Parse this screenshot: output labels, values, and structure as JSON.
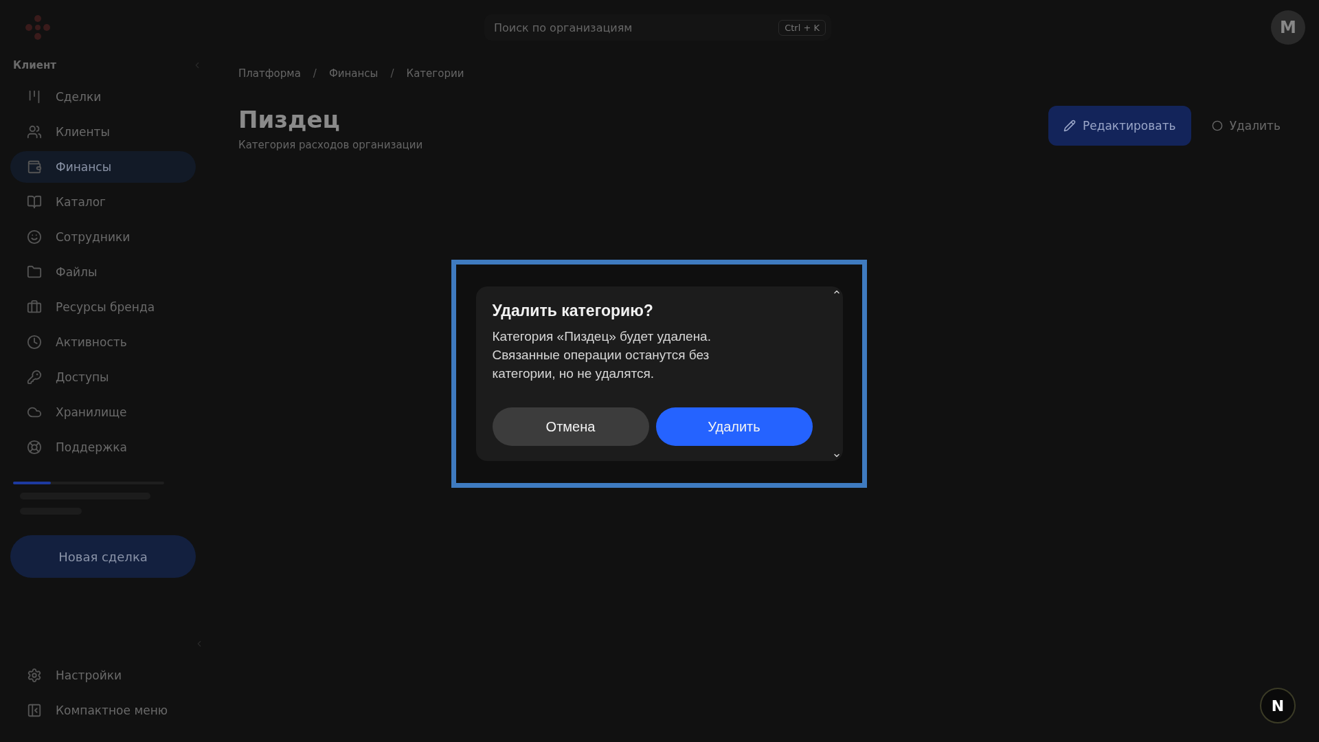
{
  "sidebar": {
    "section_label": "Клиент",
    "items": [
      {
        "label": "Сделки",
        "selected": false
      },
      {
        "label": "Клиенты",
        "selected": false
      },
      {
        "label": "Финансы",
        "selected": true
      },
      {
        "label": "Каталог",
        "selected": false
      },
      {
        "label": "Сотрудники",
        "selected": false
      },
      {
        "label": "Файлы",
        "selected": false
      },
      {
        "label": "Ресурсы бренда",
        "selected": false
      },
      {
        "label": "Активность",
        "selected": false
      },
      {
        "label": "Доступы",
        "selected": false
      },
      {
        "label": "Хранилище",
        "selected": false
      },
      {
        "label": "Поддержка",
        "selected": false
      }
    ],
    "storage": {
      "level": 0.25
    },
    "new_button": "Новая сделка",
    "footer_items": [
      {
        "label": "Настройки"
      },
      {
        "label": "Компактное меню"
      }
    ]
  },
  "header": {
    "search": {
      "placeholder": "Поиск по организациям",
      "shortcut": "Ctrl + K"
    },
    "avatar": "M"
  },
  "breadcrumbs": {
    "separator": "/",
    "items": [
      "Платформа",
      "Финансы",
      "Категории"
    ]
  },
  "page": {
    "title": "Пиздец",
    "subtitle": "Категория расходов организации",
    "edit_button": "Редактировать",
    "delete_button": "Удалить"
  },
  "dialog": {
    "title": "Удалить категорию?",
    "message": "Категория «Пиздец» будет удалена. Связанные операции останутся без категории, но не удалятся.",
    "cancel": "Отмена",
    "confirm": "Удалить"
  },
  "dev_badge": "N"
}
